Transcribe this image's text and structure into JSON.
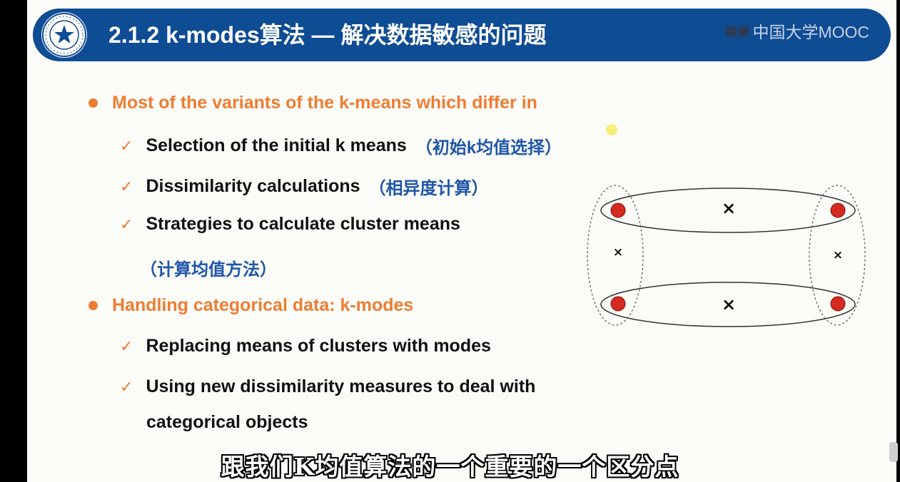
{
  "header": {
    "title": "2.1.2 k-modes算法 — 解决数据敏感的问题",
    "brand": "中国大学MOOC",
    "logo_icon": "university-seal-icon",
    "colors": {
      "bar": "#0e4c94",
      "accent": "#ed7d31",
      "chinese_note": "#1f56a8"
    }
  },
  "bullets": [
    {
      "text": "Most of the variants of the k-means which differ in",
      "items": [
        {
          "text": "Selection of the initial k means",
          "note": "（初始k均值选择）"
        },
        {
          "text": "Dissimilarity calculations",
          "note": "（相异度计算）"
        },
        {
          "text": "Strategies to calculate cluster means",
          "note": "（计算均值方法）"
        }
      ]
    },
    {
      "text": "Handling categorical data: k-modes",
      "items": [
        {
          "text": "Replacing means of clusters with modes"
        },
        {
          "text": "Using new dissimilarity measures to deal with",
          "continuation": "categorical objects"
        }
      ]
    }
  ],
  "diagram": {
    "point_color": "#d42a1f",
    "marker_symbol": "×",
    "centroid_icon": "cross-centroid-icon"
  },
  "subtitle": "跟我们K均值算法的一个重要的一个区分点"
}
